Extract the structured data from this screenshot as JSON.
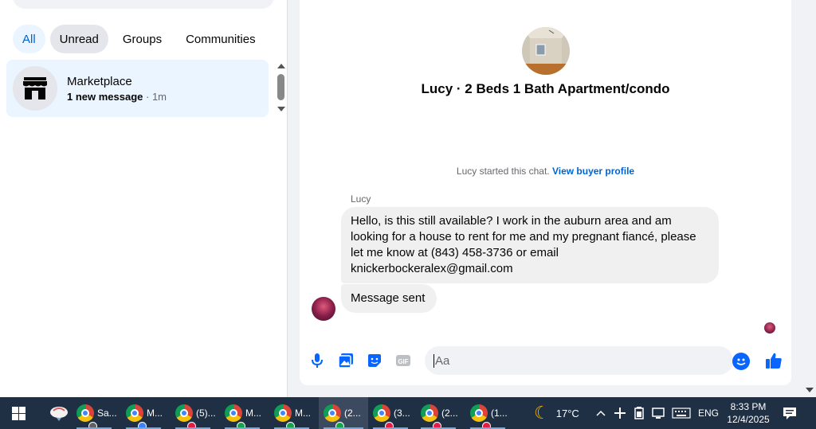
{
  "filters": [
    "All",
    "Unread",
    "Groups",
    "Communities"
  ],
  "conversation": {
    "title": "Marketplace",
    "subtitle_bold": "1 new message",
    "subtitle_time": " · 1m"
  },
  "chat": {
    "listing_title": "Lucy · 2 Beds 1 Bath Apartment/condo",
    "started_text": "Lucy started this chat. ",
    "view_profile_link": "View buyer profile",
    "sender_name": "Lucy",
    "message_1": "Hello, is this still available? I work in the auburn area and am looking for a house to rent for me and my pregnant fiancé, please let me know at (843) 458-3736 or email knickerbockeralex@gmail.com",
    "message_2": "Message sent",
    "input_placeholder": "Aa"
  },
  "taskbar": {
    "apps": [
      {
        "label": "Sa...",
        "badge_letter": "C",
        "badge_color": "#5f6368"
      },
      {
        "label": "M...",
        "badge_color": "#3b82f6"
      },
      {
        "label": "(5)...",
        "badge_color": "#e11d48"
      },
      {
        "label": "M...",
        "badge_color": "#16a34a"
      },
      {
        "label": "M...",
        "badge_color": "#16a34a"
      },
      {
        "label": "(2...",
        "badge_color": "#16a34a"
      },
      {
        "label": "(3...",
        "badge_color": "#e11d48"
      },
      {
        "label": "(2...",
        "badge_color": "#e11d48"
      },
      {
        "label": "(1...",
        "badge_color": "#e11d48"
      }
    ],
    "weather": "17°C",
    "language": "ENG",
    "time": "8:33 PM",
    "date": "12/4/2025"
  },
  "colors": {
    "accent": "#0866ff",
    "link": "#0064d1",
    "taskbar": "#1f2f44"
  },
  "icons": [
    "storefront-icon",
    "microphone-icon",
    "photo-icon",
    "sticker-icon",
    "gif-icon",
    "emoji-icon",
    "like-icon",
    "windows-start-icon",
    "chrome-icon",
    "moon-icon",
    "chevron-up-icon",
    "wifi-icon",
    "battery-icon",
    "keyboard-icon",
    "notification-icon"
  ]
}
